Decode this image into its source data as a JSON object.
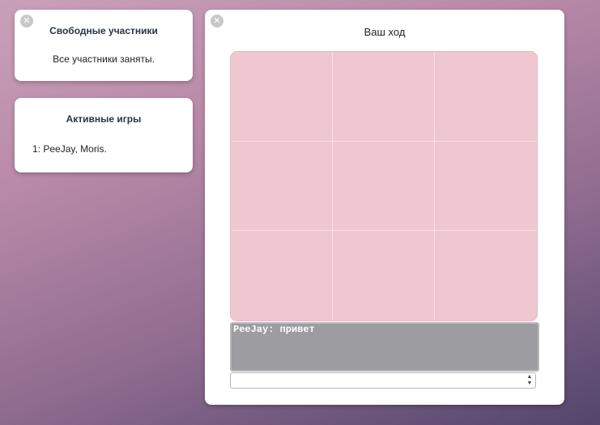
{
  "free_participants": {
    "title": "Свободные участники",
    "message": "Все участники заняты."
  },
  "active_games": {
    "title": "Активные игры",
    "items": [
      {
        "label": "1: PeeJay, Moris."
      }
    ]
  },
  "game": {
    "status": "Ваш ход",
    "board_cells": [
      "",
      "",
      "",
      "",
      "",
      "",
      "",
      "",
      ""
    ],
    "chat_log": [
      "PeeJay: привет"
    ],
    "chat_input_value": ""
  },
  "icons": {
    "close": "close-icon",
    "spinner_up": "arrow-up-icon",
    "spinner_down": "arrow-down-icon"
  },
  "colors": {
    "board": "#efc7d0",
    "chat_background": "#9c9ca1",
    "panel": "#ffffff"
  }
}
